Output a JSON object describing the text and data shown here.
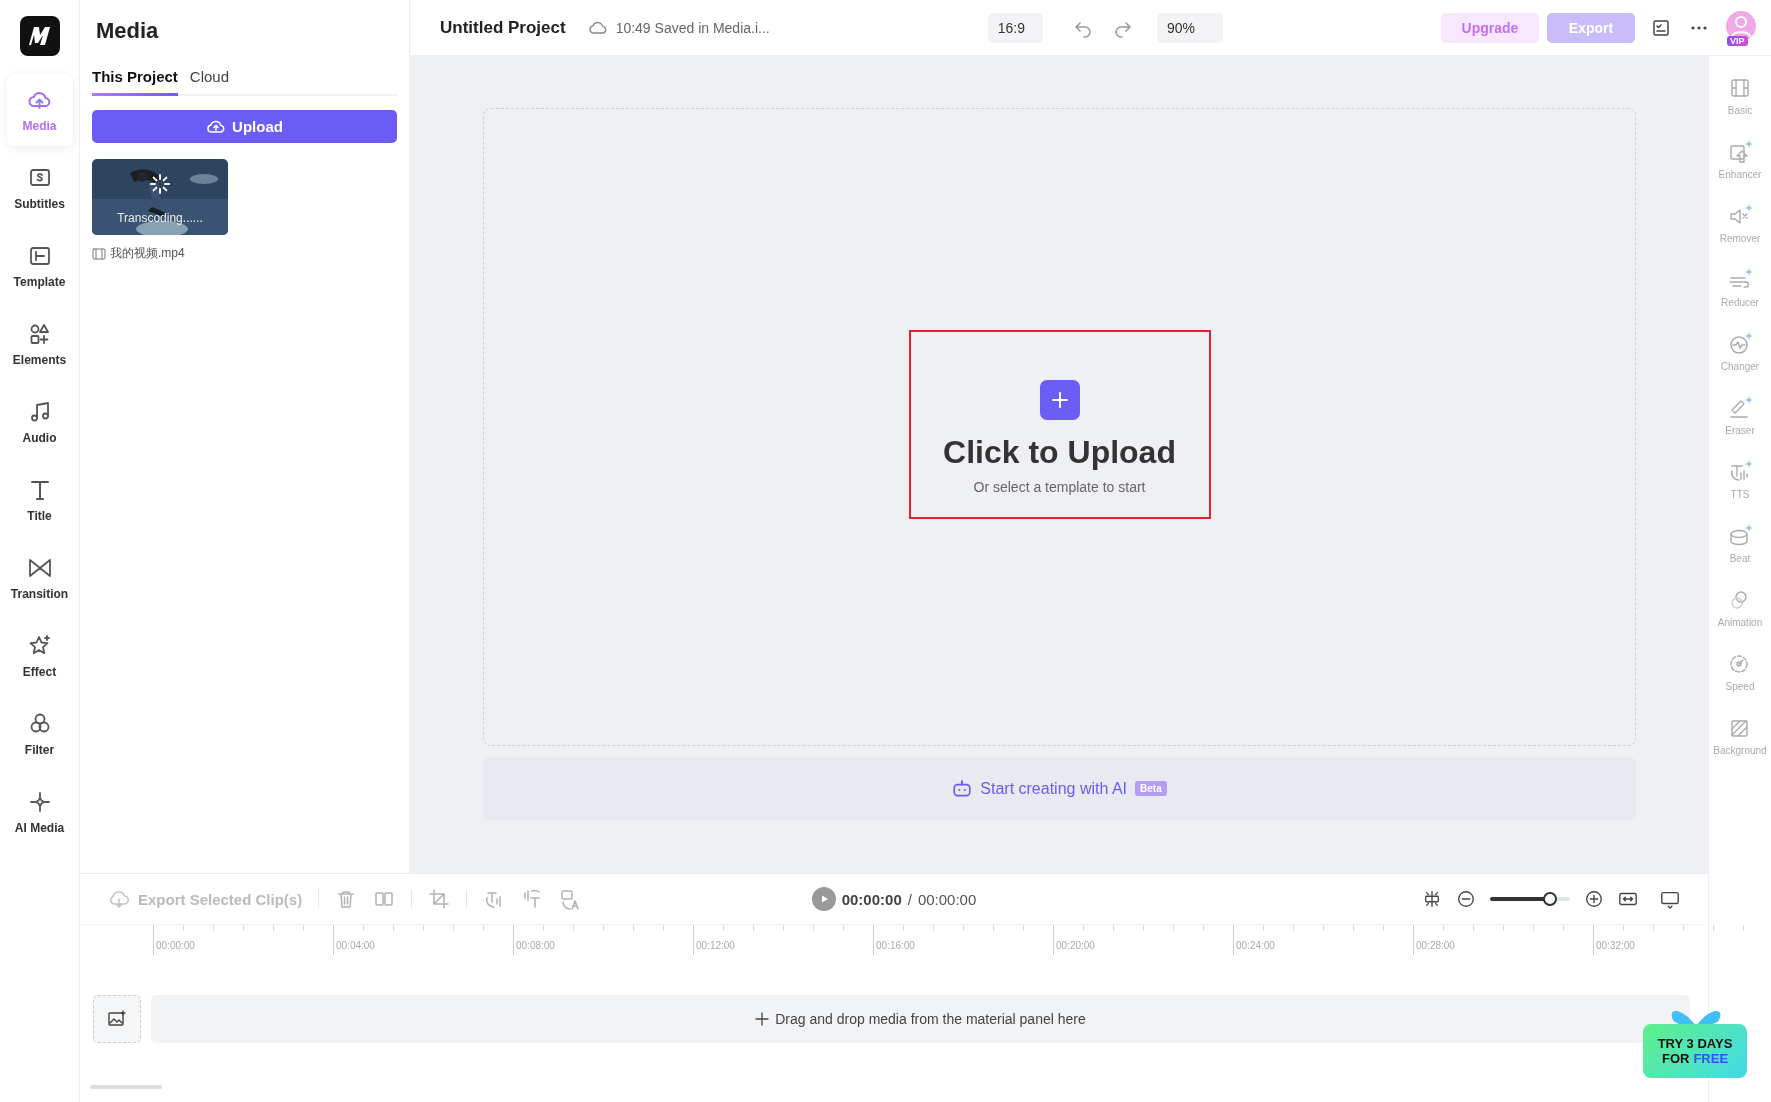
{
  "sidebar": {
    "items": [
      {
        "label": "Media",
        "kind": "media",
        "selected": true
      },
      {
        "label": "Subtitles",
        "kind": "subtitles",
        "selected": false
      },
      {
        "label": "Template",
        "kind": "template",
        "selected": false
      },
      {
        "label": "Elements",
        "kind": "elements",
        "selected": false
      },
      {
        "label": "Audio",
        "kind": "audio",
        "selected": false
      },
      {
        "label": "Title",
        "kind": "title",
        "selected": false
      },
      {
        "label": "Transition",
        "kind": "transition",
        "selected": false
      },
      {
        "label": "Effect",
        "kind": "effect",
        "selected": false
      },
      {
        "label": "Filter",
        "kind": "filter",
        "selected": false
      },
      {
        "label": "AI Media",
        "kind": "ai",
        "selected": false
      }
    ]
  },
  "media_panel": {
    "title": "Media",
    "tabs": [
      {
        "label": "This Project",
        "selected": true
      },
      {
        "label": "Cloud",
        "selected": false
      }
    ],
    "upload_button": "Upload",
    "files": [
      {
        "name": "我的视频.mp4",
        "status": "Transcoding......"
      }
    ]
  },
  "top_bar": {
    "project_title": "Untitled Project",
    "save_status": "10:49 Saved in Media.i...",
    "aspect_ratio": "16:9",
    "zoom": "90%",
    "upgrade_button": "Upgrade",
    "export_button": {
      "label": "Export",
      "disabled": true
    },
    "vip_badge": "VIP"
  },
  "canvas": {
    "upload_title": "Click to Upload",
    "upload_subtitle": "Or select a template to start",
    "highlighted": true,
    "ai_prompt": "Start creating with AI",
    "ai_badge": "Beta"
  },
  "tools_panel": {
    "items": [
      {
        "label": "Basic",
        "kind": "film",
        "ai": false
      },
      {
        "label": "Enhancer",
        "kind": "enhance",
        "ai": true
      },
      {
        "label": "Remover",
        "kind": "mute",
        "ai": true
      },
      {
        "label": "Reducer",
        "kind": "wind",
        "ai": true
      },
      {
        "label": "Changer",
        "kind": "wave",
        "ai": true
      },
      {
        "label": "Eraser",
        "kind": "eraser",
        "ai": true
      },
      {
        "label": "TTS",
        "kind": "tts",
        "ai": true
      },
      {
        "label": "Beat",
        "kind": "drum",
        "ai": true
      },
      {
        "label": "Animation",
        "kind": "circles",
        "ai": false
      },
      {
        "label": "Speed",
        "kind": "gauge",
        "ai": false
      },
      {
        "label": "Background",
        "kind": "hatch",
        "ai": false
      }
    ]
  },
  "timeline": {
    "export_clips": {
      "label": "Export Selected Clip(s)",
      "disabled": true
    },
    "current_time": "00:00:00",
    "separator": "/",
    "duration": "00:00:00",
    "zoom_slider": {
      "level": 0.75
    },
    "ruler_labels": [
      "00:00:00",
      "00:04:00",
      "00:08:00",
      "00:12:00",
      "00:16:00",
      "00:20:00",
      "00:24:00",
      "00:28:00",
      "00:32:00"
    ],
    "track_hint": "Drag and drop media from the material panel here"
  },
  "promo": {
    "line_1": "TRY 3 DAYS",
    "line_2": "FOR",
    "line_2_highlight": "FREE"
  }
}
